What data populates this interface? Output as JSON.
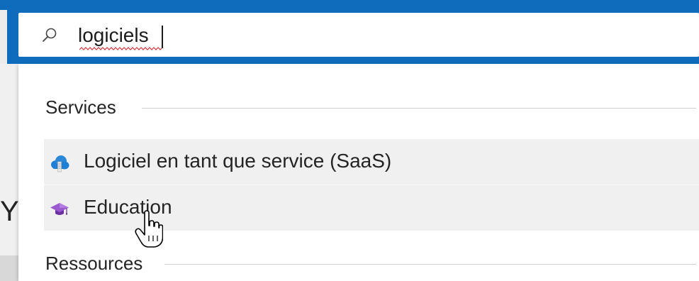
{
  "search": {
    "value": "logiciels",
    "icon": "search-icon"
  },
  "page_behind": {
    "partial_text": "Y"
  },
  "dropdown": {
    "sections": [
      {
        "title": "Services",
        "items": [
          {
            "label": "Logiciel en tant que service (SaaS)",
            "icon": "cloud-saas-icon"
          },
          {
            "label": "Education",
            "icon": "graduation-cap-icon"
          }
        ]
      },
      {
        "title": "Ressources",
        "items": []
      }
    ]
  },
  "colors": {
    "accent": "#0f6cbd",
    "row_hover": "#f0f0f0",
    "text": "#242424",
    "cap_purple": "#7b3fb0",
    "cloud_blue": "#1f7fd4"
  },
  "pointer": "hand-cursor"
}
